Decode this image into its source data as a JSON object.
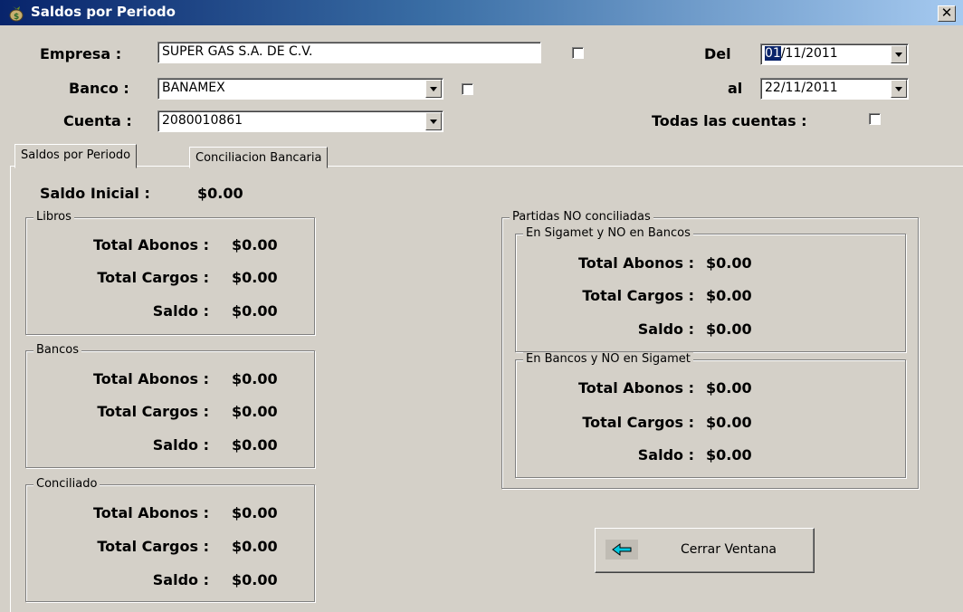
{
  "window": {
    "title": "Saldos por Periodo",
    "close_glyph": "✕"
  },
  "header": {
    "empresa_label": "Empresa :",
    "empresa_value": "SUPER GAS S.A. DE C.V.",
    "banco_label": "Banco :",
    "banco_value": "BANAMEX",
    "cuenta_label": "Cuenta :",
    "cuenta_value": "2080010861",
    "del_label": "Del",
    "del_day": "01",
    "del_rest": "/11/2011",
    "al_label": "al",
    "al_value": "22/11/2011",
    "todas_label": "Todas las cuentas :"
  },
  "tabs": [
    {
      "label": "Saldos por Periodo",
      "active": true
    },
    {
      "label": "Conciliacion Bancaria",
      "active": false
    }
  ],
  "saldo_inicial": {
    "label": "Saldo Inicial :",
    "value": "$0.00"
  },
  "groups": {
    "libros": {
      "title": "Libros",
      "abonos_label": "Total Abonos :",
      "abonos": "$0.00",
      "cargos_label": "Total Cargos :",
      "cargos": "$0.00",
      "saldo_label": "Saldo :",
      "saldo": "$0.00"
    },
    "bancos": {
      "title": "Bancos",
      "abonos_label": "Total Abonos :",
      "abonos": "$0.00",
      "cargos_label": "Total Cargos :",
      "cargos": "$0.00",
      "saldo_label": "Saldo :",
      "saldo": "$0.00"
    },
    "conciliado": {
      "title": "Conciliado",
      "abonos_label": "Total Abonos :",
      "abonos": "$0.00",
      "cargos_label": "Total Cargos :",
      "cargos": "$0.00",
      "saldo_label": "Saldo :",
      "saldo": "$0.00"
    },
    "partidas": {
      "title": "Partidas NO conciliadas"
    },
    "sigamet": {
      "title": "En Sigamet y NO en Bancos",
      "abonos_label": "Total Abonos :",
      "abonos": "$0.00",
      "cargos_label": "Total Cargos :",
      "cargos": "$0.00",
      "saldo_label": "Saldo :",
      "saldo": "$0.00"
    },
    "en_bancos": {
      "title": "En Bancos y NO en Sigamet",
      "abonos_label": "Total Abonos :",
      "abonos": "$0.00",
      "cargos_label": "Total Cargos :",
      "cargos": "$0.00",
      "saldo_label": "Saldo :",
      "saldo": "$0.00"
    }
  },
  "buttons": {
    "close_window_label": "Cerrar Ventana",
    "close_window_icon": "arrow-left-icon"
  },
  "colors": {
    "title_bar": "#08246b",
    "face": "#d4d0c8",
    "selection": "#0a246a",
    "arrow": "#00c8e0"
  }
}
